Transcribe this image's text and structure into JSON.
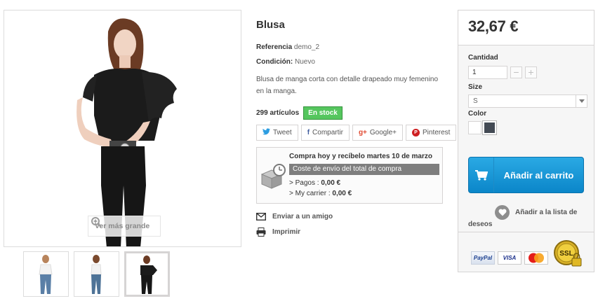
{
  "product": {
    "title": "Blusa",
    "reference_label": "Referencia",
    "reference_value": "demo_2",
    "condition_label": "Condición:",
    "condition_value": "Nuevo",
    "description": "Blusa de manga corta con detalle drapeado muy femenino en la manga.",
    "stock_count": "299 artículos",
    "stock_badge": "En stock"
  },
  "gallery": {
    "zoom_hint": "Ver más grande",
    "thumbnails": [
      "white-top-jeans",
      "white-top-jeans-back",
      "black-top"
    ],
    "active_thumbnail": 3
  },
  "social": {
    "tweet": "Tweet",
    "share": "Compartir",
    "googleplus": "Google+",
    "pinterest": "Pinterest"
  },
  "shipping": {
    "headline": "Compra hoy y recíbelo martes 10 de marzo",
    "bar": "Coste de envío del total de compra",
    "line1_label": "> Pagos : ",
    "line1_value": "0,00 €",
    "line2_label": "> My carrier : ",
    "line2_value": "0,00 €"
  },
  "links": {
    "send_friend": "Enviar a un amigo",
    "print": "Imprimir"
  },
  "buybox": {
    "price": "32,67 €",
    "quantity_label": "Cantidad",
    "quantity_value": "1",
    "size_label": "Size",
    "size_value": "S",
    "color_label": "Color",
    "colors": [
      "#ffffff",
      "#434a54"
    ],
    "add_to_cart": "Añadir al carrito",
    "wishlist_line1": "Añadir a la lista de",
    "wishlist_line2": "deseos",
    "payment_logos": {
      "paypal": "PayPal",
      "visa": "VISA",
      "mastercard": "MasterCard",
      "ssl": "SSL"
    }
  },
  "colors": {
    "accent": "#1a96d6",
    "stock_green": "#55c65e",
    "bar_gray": "#7e7e7e"
  }
}
